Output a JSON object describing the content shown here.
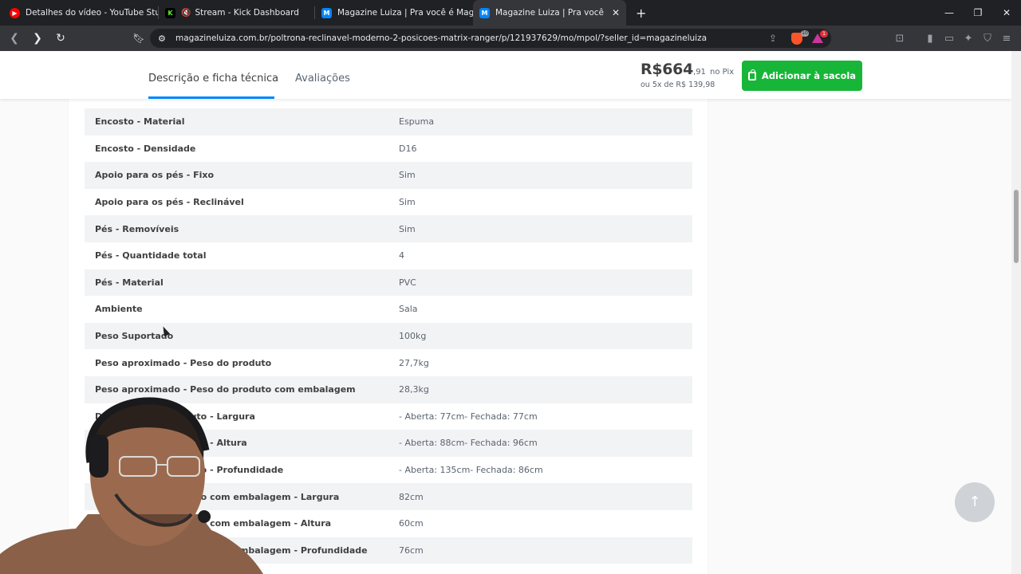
{
  "tabs": [
    {
      "title": "Detalhes do vídeo - YouTube Studio",
      "icon": "youtube-icon",
      "color": "#ff0000"
    },
    {
      "title": "Stream - Kick Dashboard",
      "icon": "kick-icon",
      "color": "#53fc18"
    },
    {
      "title": "Magazine Luiza | Pra você é Magalu!",
      "icon": "magalu-icon",
      "color": "#0086ff"
    },
    {
      "title": "Magazine Luiza | Pra você é Mag",
      "icon": "magalu-icon",
      "color": "#0086ff"
    }
  ],
  "address": {
    "url": "magazineluiza.com.br/poltrona-reclinavel-moderno-2-posicoes-matrix-ranger/p/121937629/mo/mpol/?seller_id=magazineluiza",
    "brave_badge": "10",
    "rewards_badge": "1"
  },
  "product_header": {
    "tab_description": "Descrição e ficha técnica",
    "tab_reviews": "Avaliações",
    "price_main": "R$664",
    "price_cents": ",91",
    "price_method": "no Pix",
    "installments": "ou 5x de R$ 139,98",
    "add_to_bag": "Adicionar à sacola"
  },
  "specs": [
    {
      "key": "Encosto - Material",
      "value": "Espuma"
    },
    {
      "key": "Encosto - Densidade",
      "value": "D16"
    },
    {
      "key": "Apoio para os pés - Fixo",
      "value": "Sim"
    },
    {
      "key": "Apoio para os pés - Reclinável",
      "value": "Sim"
    },
    {
      "key": "Pés - Removíveis",
      "value": "Sim"
    },
    {
      "key": "Pés - Quantidade total",
      "value": "4"
    },
    {
      "key": "Pés - Material",
      "value": "PVC"
    },
    {
      "key": "Ambiente",
      "value": "Sala"
    },
    {
      "key": "Peso Suportado",
      "value": "100kg"
    },
    {
      "key": "Peso aproximado - Peso do produto",
      "value": "27,7kg"
    },
    {
      "key": "Peso aproximado - Peso do produto com embalagem",
      "value": "28,3kg"
    },
    {
      "key": "Dimensões do produto - Largura",
      "value": "- Aberta: 77cm- Fechada: 77cm"
    },
    {
      "key": "Dimensões do produto - Altura",
      "value": "- Aberta: 88cm- Fechada: 96cm"
    },
    {
      "key": "Dimensões do produto - Profundidade",
      "value": "- Aberta: 135cm- Fechada: 86cm"
    },
    {
      "key": "Dimensões do produto com embalagem - Largura",
      "value": "82cm"
    },
    {
      "key": "Dimensões do produto com embalagem - Altura",
      "value": "60cm"
    },
    {
      "key": "Dimensões do produto com embalagem - Profundidade",
      "value": "76cm"
    }
  ],
  "colors": {
    "accent_blue": "#0086ff",
    "buy_green": "#17b638",
    "row_shade": "#f2f3f5"
  }
}
